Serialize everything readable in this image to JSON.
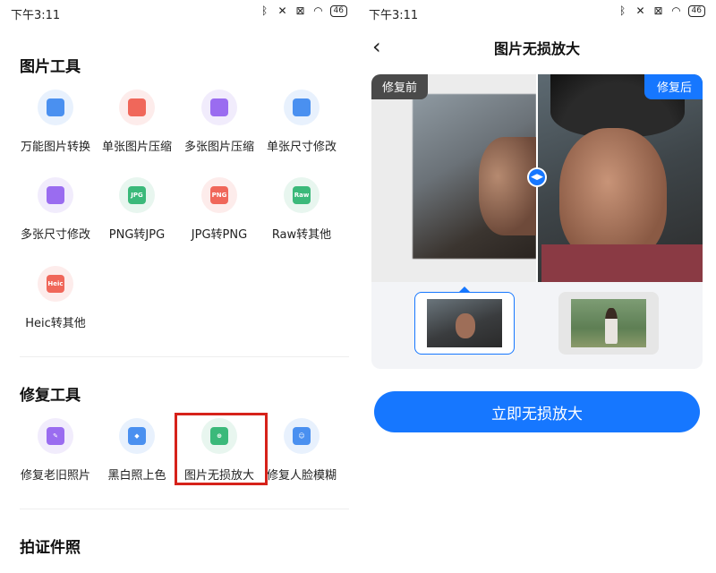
{
  "status_bar": {
    "time": "下午3:11",
    "battery": "46",
    "icons": [
      "bluetooth-icon",
      "mute-icon",
      "sim-off-icon",
      "wifi-icon",
      "battery-icon"
    ]
  },
  "left_screen": {
    "sections": [
      {
        "title": "图片工具",
        "tools": [
          {
            "label": "万能图片转换",
            "icon": "image-convert-icon",
            "bg": "#e8f1fd",
            "fg": "#4a90f0",
            "glyph": ""
          },
          {
            "label": "单张图片压缩",
            "icon": "image-compress-icon",
            "bg": "#fdeceb",
            "fg": "#f0675a",
            "glyph": ""
          },
          {
            "label": "多张图片压缩",
            "icon": "images-compress-icon",
            "bg": "#f1ecfc",
            "fg": "#9a6cf0",
            "glyph": ""
          },
          {
            "label": "单张尺寸修改",
            "icon": "image-resize-icon",
            "bg": "#e8f1fd",
            "fg": "#4a90f0",
            "glyph": ""
          },
          {
            "label": "多张尺寸修改",
            "icon": "images-resize-icon",
            "bg": "#f1ecfc",
            "fg": "#9a6cf0",
            "glyph": ""
          },
          {
            "label": "PNG转JPG",
            "icon": "jpg-file-icon",
            "bg": "#e8f6ef",
            "fg": "#3bb97a",
            "glyph": "JPG"
          },
          {
            "label": "JPG转PNG",
            "icon": "png-file-icon",
            "bg": "#fdeceb",
            "fg": "#f0675a",
            "glyph": "PNG"
          },
          {
            "label": "Raw转其他",
            "icon": "raw-file-icon",
            "bg": "#e8f6ef",
            "fg": "#3bb97a",
            "glyph": "Raw"
          },
          {
            "label": "Heic转其他",
            "icon": "heic-file-icon",
            "bg": "#fdeceb",
            "fg": "#f0675a",
            "glyph": "Heic"
          }
        ]
      },
      {
        "title": "修复工具",
        "tools": [
          {
            "label": "修复老旧照片",
            "icon": "repair-wrench-icon",
            "bg": "#f1ecfc",
            "fg": "#9a6cf0",
            "glyph": ""
          },
          {
            "label": "黑白照上色",
            "icon": "paint-bucket-icon",
            "bg": "#e8f1fd",
            "fg": "#4a90f0",
            "glyph": ""
          },
          {
            "label": "图片无损放大",
            "icon": "zoom-in-icon",
            "bg": "#e8f6ef",
            "fg": "#3bb97a",
            "glyph": ""
          },
          {
            "label": "修复人脸模糊",
            "icon": "face-repair-icon",
            "bg": "#e8f1fd",
            "fg": "#4a90f0",
            "glyph": ""
          }
        ]
      },
      {
        "title": "拍证件照",
        "tools": []
      }
    ]
  },
  "right_screen": {
    "title": "图片无损放大",
    "before_tag": "修复前",
    "after_tag": "修复后",
    "action_button": "立即无损放大",
    "accent": "#1677ff"
  }
}
